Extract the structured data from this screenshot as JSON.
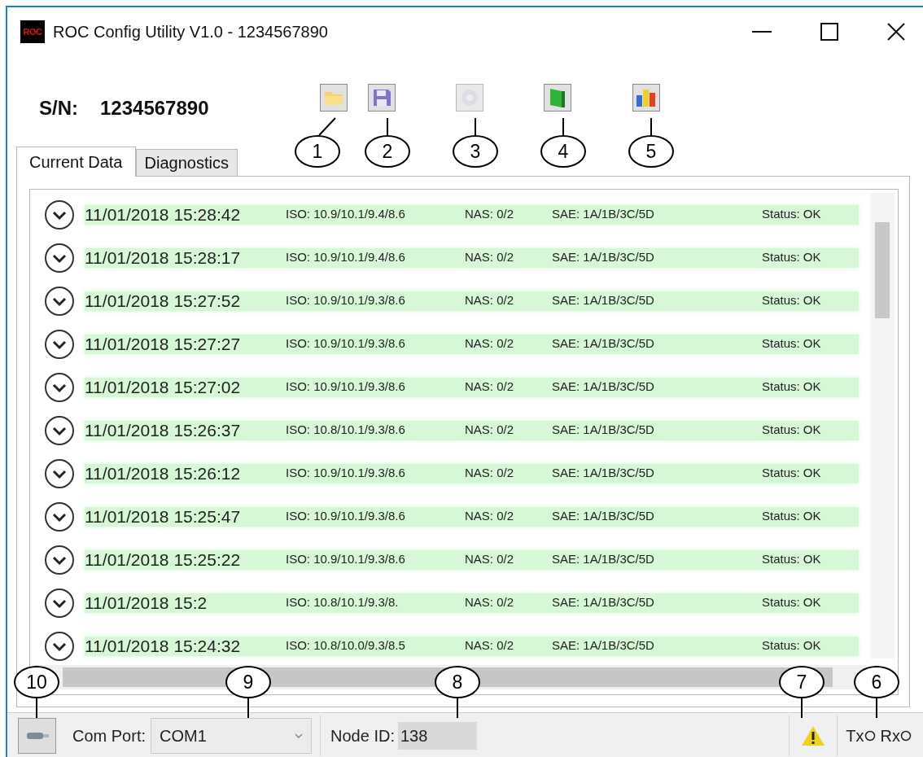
{
  "window": {
    "logo_text": "ROC",
    "title": "ROC Config Utility V1.0 - 1234567890"
  },
  "serial": {
    "label": "S/N:",
    "value": "1234567890"
  },
  "toolbar": [
    {
      "kind": "open",
      "disabled": false
    },
    {
      "kind": "save",
      "disabled": false
    },
    {
      "kind": "settings",
      "disabled": true
    },
    {
      "kind": "book",
      "disabled": false
    },
    {
      "kind": "chart",
      "disabled": false
    }
  ],
  "tabs": [
    {
      "label": "Current Data",
      "selected": true
    },
    {
      "label": "Diagnostics",
      "selected": false
    }
  ],
  "rows": [
    {
      "datetime": "11/01/2018 15:28:42",
      "iso": "ISO: 10.9/10.1/9.4/8.6",
      "nas": "NAS: 0/2",
      "sae": "SAE: 1A/1B/3C/5D",
      "status": "Status: OK"
    },
    {
      "datetime": "11/01/2018 15:28:17",
      "iso": "ISO: 10.9/10.1/9.4/8.6",
      "nas": "NAS: 0/2",
      "sae": "SAE: 1A/1B/3C/5D",
      "status": "Status: OK"
    },
    {
      "datetime": "11/01/2018 15:27:52",
      "iso": "ISO: 10.9/10.1/9.3/8.6",
      "nas": "NAS: 0/2",
      "sae": "SAE: 1A/1B/3C/5D",
      "status": "Status: OK"
    },
    {
      "datetime": "11/01/2018 15:27:27",
      "iso": "ISO: 10.9/10.1/9.3/8.6",
      "nas": "NAS: 0/2",
      "sae": "SAE: 1A/1B/3C/5D",
      "status": "Status: OK"
    },
    {
      "datetime": "11/01/2018 15:27:02",
      "iso": "ISO: 10.9/10.1/9.3/8.6",
      "nas": "NAS: 0/2",
      "sae": "SAE: 1A/1B/3C/5D",
      "status": "Status: OK"
    },
    {
      "datetime": "11/01/2018 15:26:37",
      "iso": "ISO: 10.8/10.1/9.3/8.6",
      "nas": "NAS: 0/2",
      "sae": "SAE: 1A/1B/3C/5D",
      "status": "Status: OK"
    },
    {
      "datetime": "11/01/2018 15:26:12",
      "iso": "ISO: 10.9/10.1/9.3/8.6",
      "nas": "NAS: 0/2",
      "sae": "SAE: 1A/1B/3C/5D",
      "status": "Status: OK"
    },
    {
      "datetime": "11/01/2018 15:25:47",
      "iso": "ISO: 10.9/10.1/9.3/8.6",
      "nas": "NAS: 0/2",
      "sae": "SAE: 1A/1B/3C/5D",
      "status": "Status: OK"
    },
    {
      "datetime": "11/01/2018 15:25:22",
      "iso": "ISO: 10.9/10.1/9.3/8.6",
      "nas": "NAS: 0/2",
      "sae": "SAE: 1A/1B/3C/5D",
      "status": "Status: OK"
    },
    {
      "datetime": "11/01/2018 15:2",
      "iso": "ISO: 10.8/10.1/9.3/8.",
      "nas": "NAS: 0/2",
      "sae": "SAE: 1A/1B/3C/5D",
      "status": "Status: OK"
    },
    {
      "datetime": "11/01/2018 15:24:32",
      "iso": "ISO: 10.8/10.0/9.3/8.5",
      "nas": "NAS: 0/2",
      "sae": "SAE: 1A/1B/3C/5D",
      "status": "Status: OK"
    }
  ],
  "status_bar": {
    "com_port_label": "Com Port:",
    "com_port": "COM1",
    "node_id_label": "Node ID:",
    "node_id": "138",
    "tx": "Tx",
    "rx": "Rx"
  },
  "callouts": [
    "1",
    "2",
    "3",
    "4",
    "5",
    "10",
    "9",
    "8",
    "7",
    "6"
  ]
}
